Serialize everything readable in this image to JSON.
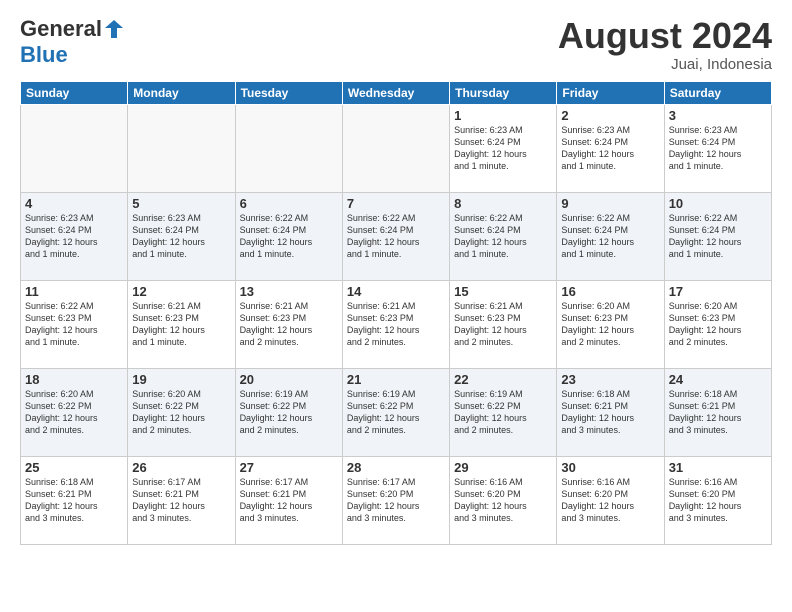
{
  "header": {
    "logo_general": "General",
    "logo_blue": "Blue",
    "title": "August 2024",
    "subtitle": "Juai, Indonesia"
  },
  "days_of_week": [
    "Sunday",
    "Monday",
    "Tuesday",
    "Wednesday",
    "Thursday",
    "Friday",
    "Saturday"
  ],
  "weeks": [
    [
      {
        "day": "",
        "info": ""
      },
      {
        "day": "",
        "info": ""
      },
      {
        "day": "",
        "info": ""
      },
      {
        "day": "",
        "info": ""
      },
      {
        "day": "1",
        "info": "Sunrise: 6:23 AM\nSunset: 6:24 PM\nDaylight: 12 hours\nand 1 minute."
      },
      {
        "day": "2",
        "info": "Sunrise: 6:23 AM\nSunset: 6:24 PM\nDaylight: 12 hours\nand 1 minute."
      },
      {
        "day": "3",
        "info": "Sunrise: 6:23 AM\nSunset: 6:24 PM\nDaylight: 12 hours\nand 1 minute."
      }
    ],
    [
      {
        "day": "4",
        "info": "Sunrise: 6:23 AM\nSunset: 6:24 PM\nDaylight: 12 hours\nand 1 minute."
      },
      {
        "day": "5",
        "info": "Sunrise: 6:23 AM\nSunset: 6:24 PM\nDaylight: 12 hours\nand 1 minute."
      },
      {
        "day": "6",
        "info": "Sunrise: 6:22 AM\nSunset: 6:24 PM\nDaylight: 12 hours\nand 1 minute."
      },
      {
        "day": "7",
        "info": "Sunrise: 6:22 AM\nSunset: 6:24 PM\nDaylight: 12 hours\nand 1 minute."
      },
      {
        "day": "8",
        "info": "Sunrise: 6:22 AM\nSunset: 6:24 PM\nDaylight: 12 hours\nand 1 minute."
      },
      {
        "day": "9",
        "info": "Sunrise: 6:22 AM\nSunset: 6:24 PM\nDaylight: 12 hours\nand 1 minute."
      },
      {
        "day": "10",
        "info": "Sunrise: 6:22 AM\nSunset: 6:24 PM\nDaylight: 12 hours\nand 1 minute."
      }
    ],
    [
      {
        "day": "11",
        "info": "Sunrise: 6:22 AM\nSunset: 6:23 PM\nDaylight: 12 hours\nand 1 minute."
      },
      {
        "day": "12",
        "info": "Sunrise: 6:21 AM\nSunset: 6:23 PM\nDaylight: 12 hours\nand 1 minute."
      },
      {
        "day": "13",
        "info": "Sunrise: 6:21 AM\nSunset: 6:23 PM\nDaylight: 12 hours\nand 2 minutes."
      },
      {
        "day": "14",
        "info": "Sunrise: 6:21 AM\nSunset: 6:23 PM\nDaylight: 12 hours\nand 2 minutes."
      },
      {
        "day": "15",
        "info": "Sunrise: 6:21 AM\nSunset: 6:23 PM\nDaylight: 12 hours\nand 2 minutes."
      },
      {
        "day": "16",
        "info": "Sunrise: 6:20 AM\nSunset: 6:23 PM\nDaylight: 12 hours\nand 2 minutes."
      },
      {
        "day": "17",
        "info": "Sunrise: 6:20 AM\nSunset: 6:23 PM\nDaylight: 12 hours\nand 2 minutes."
      }
    ],
    [
      {
        "day": "18",
        "info": "Sunrise: 6:20 AM\nSunset: 6:22 PM\nDaylight: 12 hours\nand 2 minutes."
      },
      {
        "day": "19",
        "info": "Sunrise: 6:20 AM\nSunset: 6:22 PM\nDaylight: 12 hours\nand 2 minutes."
      },
      {
        "day": "20",
        "info": "Sunrise: 6:19 AM\nSunset: 6:22 PM\nDaylight: 12 hours\nand 2 minutes."
      },
      {
        "day": "21",
        "info": "Sunrise: 6:19 AM\nSunset: 6:22 PM\nDaylight: 12 hours\nand 2 minutes."
      },
      {
        "day": "22",
        "info": "Sunrise: 6:19 AM\nSunset: 6:22 PM\nDaylight: 12 hours\nand 2 minutes."
      },
      {
        "day": "23",
        "info": "Sunrise: 6:18 AM\nSunset: 6:21 PM\nDaylight: 12 hours\nand 3 minutes."
      },
      {
        "day": "24",
        "info": "Sunrise: 6:18 AM\nSunset: 6:21 PM\nDaylight: 12 hours\nand 3 minutes."
      }
    ],
    [
      {
        "day": "25",
        "info": "Sunrise: 6:18 AM\nSunset: 6:21 PM\nDaylight: 12 hours\nand 3 minutes."
      },
      {
        "day": "26",
        "info": "Sunrise: 6:17 AM\nSunset: 6:21 PM\nDaylight: 12 hours\nand 3 minutes."
      },
      {
        "day": "27",
        "info": "Sunrise: 6:17 AM\nSunset: 6:21 PM\nDaylight: 12 hours\nand 3 minutes."
      },
      {
        "day": "28",
        "info": "Sunrise: 6:17 AM\nSunset: 6:20 PM\nDaylight: 12 hours\nand 3 minutes."
      },
      {
        "day": "29",
        "info": "Sunrise: 6:16 AM\nSunset: 6:20 PM\nDaylight: 12 hours\nand 3 minutes."
      },
      {
        "day": "30",
        "info": "Sunrise: 6:16 AM\nSunset: 6:20 PM\nDaylight: 12 hours\nand 3 minutes."
      },
      {
        "day": "31",
        "info": "Sunrise: 6:16 AM\nSunset: 6:20 PM\nDaylight: 12 hours\nand 3 minutes."
      }
    ]
  ]
}
